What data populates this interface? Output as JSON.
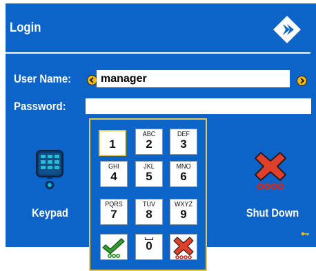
{
  "window": {
    "title": "Login"
  },
  "form": {
    "username_label": "User Name:",
    "username_value": "manager",
    "password_label": "Password:",
    "password_value": ""
  },
  "actions": {
    "keypad_label": "Keypad",
    "shutdown_label": "Shut Down"
  },
  "keypad": {
    "keys": [
      {
        "digit": "1",
        "letters": ""
      },
      {
        "digit": "2",
        "letters": "ABC"
      },
      {
        "digit": "3",
        "letters": "DEF"
      },
      {
        "digit": "4",
        "letters": "GHI"
      },
      {
        "digit": "5",
        "letters": "JKL"
      },
      {
        "digit": "6",
        "letters": "MNO"
      },
      {
        "digit": "7",
        "letters": "PQRS"
      },
      {
        "digit": "8",
        "letters": "TUV"
      },
      {
        "digit": "9",
        "letters": "WXYZ"
      },
      {
        "digit": "0",
        "letters": ""
      }
    ],
    "selected_key": "1"
  },
  "colors": {
    "panel": "#0c64c8",
    "accent": "#f1b90d",
    "confirm": "#2e9e2e",
    "cancel": "#e0402a"
  }
}
